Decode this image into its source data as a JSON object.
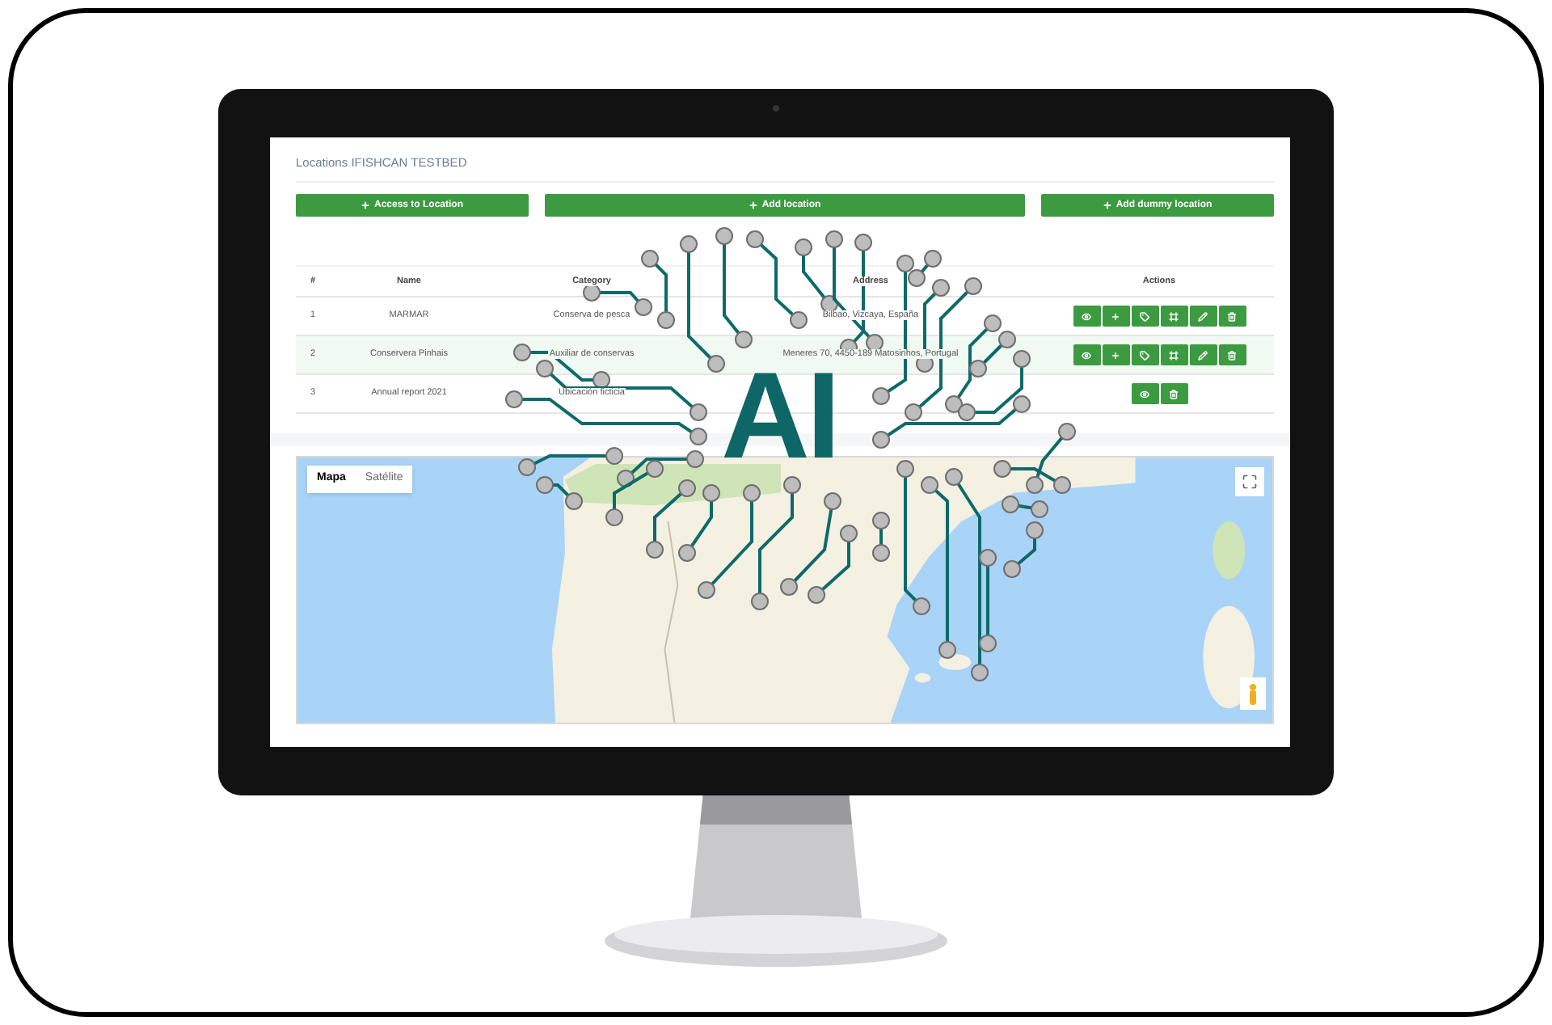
{
  "page": {
    "title": "Locations IFISHCAN TESTBED"
  },
  "buttons": [
    {
      "label": "Access to Location"
    },
    {
      "label": "Add location"
    },
    {
      "label": "Add dummy location"
    }
  ],
  "table": {
    "columns": [
      "#",
      "Name",
      "Category",
      "Address",
      "Actions"
    ],
    "rows": [
      {
        "selected": false,
        "cells": [
          "1",
          "MARMAR",
          "Conserva de pesca",
          "Bilbao, Vizcaya, España"
        ],
        "actions": [
          {
            "kind": "view"
          },
          {
            "kind": "add"
          },
          {
            "kind": "tag"
          },
          {
            "kind": "frame"
          },
          {
            "kind": "edit"
          },
          {
            "kind": "delete"
          }
        ]
      },
      {
        "selected": true,
        "cells": [
          "2",
          "Conservera Pinhais",
          "Auxiliar de conservas",
          "Meneres 70, 4450-189 Matosinhos, Portugal"
        ],
        "actions": [
          {
            "kind": "view"
          },
          {
            "kind": "add"
          },
          {
            "kind": "tag"
          },
          {
            "kind": "frame"
          },
          {
            "kind": "edit"
          },
          {
            "kind": "delete"
          }
        ]
      },
      {
        "selected": false,
        "cells": [
          "3",
          "Annual report 2021",
          "Ubicación ficticia",
          ""
        ],
        "actions": [
          {
            "kind": "view"
          },
          {
            "kind": "delete"
          }
        ]
      }
    ]
  },
  "map": {
    "map_types": [
      {
        "label": "Mapa",
        "selected": true
      },
      {
        "label": "Satélite",
        "selected": false
      }
    ]
  },
  "overlay": {
    "text": "AI"
  }
}
